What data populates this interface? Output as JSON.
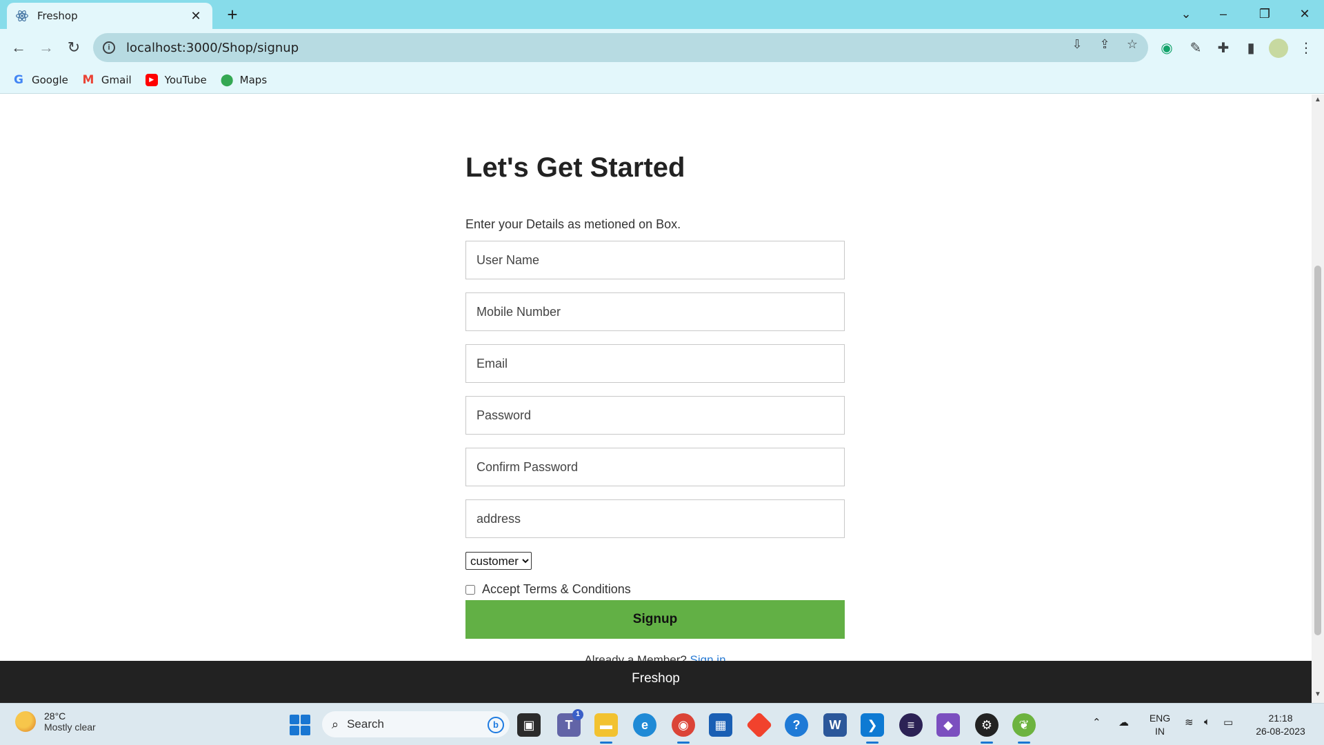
{
  "browser": {
    "tab_title": "Freshop",
    "url": "localhost:3000/Shop/signup",
    "bookmarks": [
      "Google",
      "Gmail",
      "YouTube",
      "Maps"
    ]
  },
  "page": {
    "title": "Let's Get Started",
    "subtitle": "Enter your Details as metioned on Box.",
    "fields": {
      "username_placeholder": "User Name",
      "mobile_placeholder": "Mobile Number",
      "email_placeholder": "Email",
      "password_placeholder": "Password",
      "confirm_password_placeholder": "Confirm Password",
      "address_placeholder": "address"
    },
    "role_select_value": "customer",
    "terms_label": "Accept Terms & Conditions",
    "terms_checked": false,
    "signup_label": "Signup",
    "member_text": "Already a Member?",
    "signin_link": "Sign in",
    "footer_text": "Freshop"
  },
  "taskbar": {
    "weather_temp": "28°C",
    "weather_condition": "Mostly clear",
    "search_label": "Search",
    "teams_badge": "1",
    "lang_top": "ENG",
    "lang_bottom": "IN",
    "time": "21:18",
    "date": "26-08-2023"
  },
  "colors": {
    "tabstrip": "#87dcea",
    "toolbar": "#e3f7fb",
    "signup_button": "#62b045",
    "footer": "#222222",
    "link": "#2a7bd3"
  }
}
